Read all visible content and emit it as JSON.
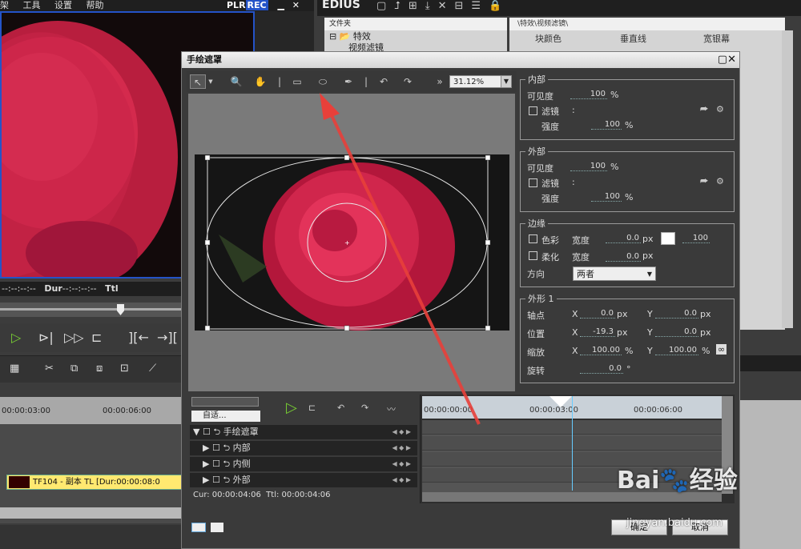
{
  "main_menu": {
    "item1": "架",
    "item2": "工具",
    "item3": "设置",
    "item4": "帮助"
  },
  "player": {
    "plr": "PLR",
    "rec": "REC",
    "in_tc": "--:--:--:--",
    "dur_label": "Dur",
    "dur_tc": "--:--:--:--",
    "ttl_label": "Ttl"
  },
  "timeline": {
    "ruler": [
      "00:00:03:00",
      "00:00:06:00"
    ],
    "clip_label": "TF104 - 副本  TL [Dur:00:00:08:0"
  },
  "app": {
    "title": "EDIUS"
  },
  "folder_panel": {
    "header": "文件夹",
    "root": "特效",
    "child": "视频滤镜"
  },
  "effects_panel": {
    "path": "\\特效\\视频滤镜\\",
    "items": [
      "块颜色",
      "垂直线",
      "宽银幕"
    ]
  },
  "dialog": {
    "title": "手绘遮罩",
    "zoom": "31.12%",
    "inner": {
      "title": "内部",
      "visibility_label": "可见度",
      "visibility": "100",
      "unit_pct": "%",
      "filter_label": "滤镜",
      "colon": ":",
      "strength_label": "强度",
      "strength": "100"
    },
    "outer": {
      "title": "外部",
      "visibility_label": "可见度",
      "visibility": "100",
      "unit_pct": "%",
      "filter_label": "滤镜",
      "colon": ":",
      "strength_label": "强度",
      "strength": "100"
    },
    "edge": {
      "title": "边缘",
      "color_label": "色彩",
      "width_label": "宽度",
      "color_width": "0.0",
      "unit_px": "px",
      "color_pct": "100",
      "soft_label": "柔化",
      "soft_width": "0.0",
      "direction_label": "方向",
      "direction": "两者"
    },
    "shape": {
      "title": "外形 1",
      "pivot_label": "轴点",
      "pivot_x": "0.0",
      "pivot_y": "0.0",
      "position_label": "位置",
      "pos_x": "-19.3",
      "pos_y": "0.0",
      "scale_label": "缩放",
      "scale_x": "100.00",
      "scale_y": "100.00",
      "rotate_label": "旋转",
      "rotate": "0.0",
      "unit_deg": "°",
      "x": "X",
      "y": "Y"
    },
    "keyframe": {
      "fit_label": "自适...",
      "ruler": [
        "00:00:00:00",
        "00:00:03:00",
        "00:00:06:00"
      ],
      "tracks": [
        "手绘遮罩",
        "内部",
        "内侧",
        "外部"
      ],
      "cur": "Cur: 00:00:04:06",
      "ttl": "Ttl: 00:00:04:06"
    },
    "ok": "确定",
    "cancel": "取消"
  },
  "watermark": {
    "text": "Bai🐾经验",
    "url": "jingyan.baidu.com"
  },
  "colors": {
    "accent_blue": "#2453c8",
    "arrow_red": "#e8403a"
  }
}
